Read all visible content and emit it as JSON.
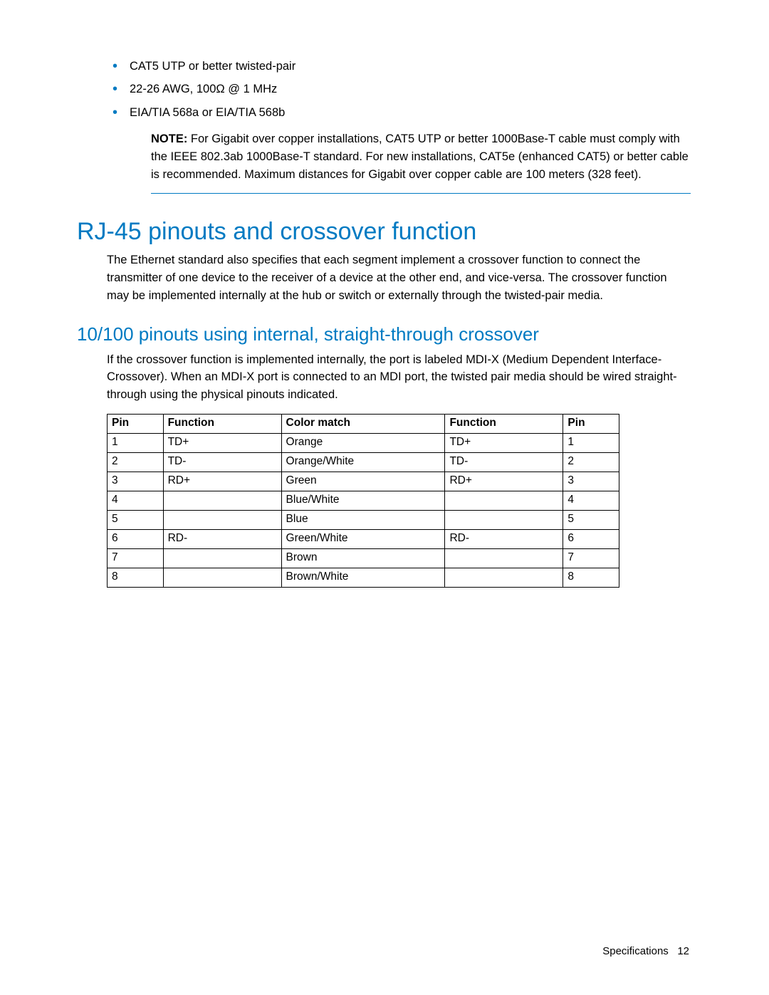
{
  "bullets": {
    "items": [
      "CAT5 UTP or better twisted-pair",
      "22-26 AWG, 100Ω @ 1 MHz",
      "EIA/TIA 568a or EIA/TIA 568b"
    ]
  },
  "note": {
    "label": "NOTE:",
    "text": "  For Gigabit over copper installations, CAT5 UTP or better 1000Base-T cable must comply with the IEEE 802.3ab 1000Base-T standard. For new installations, CAT5e (enhanced CAT5) or better cable is recommended. Maximum distances for Gigabit over copper cable are 100 meters (328 feet)."
  },
  "heading1": "RJ-45 pinouts and crossover function",
  "body1": "The Ethernet standard also specifies that each segment implement a crossover function to connect the transmitter of one device to the receiver of a device at the other end, and vice-versa. The crossover function may be implemented internally at the hub or switch or externally through the twisted-pair media.",
  "heading2": "10/100 pinouts using internal, straight-through crossover",
  "body2": "If the crossover function is implemented internally, the port is labeled MDI-X (Medium Dependent Interface-Crossover). When an MDI-X port is connected to an MDI port, the twisted pair media should be wired straight-through using the physical pinouts indicated.",
  "table": {
    "headers": [
      "Pin",
      "Function",
      "Color match",
      "Function",
      "Pin"
    ],
    "rows": [
      [
        "1",
        "TD+",
        "Orange",
        "TD+",
        "1"
      ],
      [
        "2",
        "TD-",
        "Orange/White",
        "TD-",
        "2"
      ],
      [
        "3",
        "RD+",
        "Green",
        "RD+",
        "3"
      ],
      [
        "4",
        "",
        "Blue/White",
        "",
        "4"
      ],
      [
        "5",
        "",
        "Blue",
        "",
        "5"
      ],
      [
        "6",
        "RD-",
        "Green/White",
        "RD-",
        "6"
      ],
      [
        "7",
        "",
        "Brown",
        "",
        "7"
      ],
      [
        "8",
        "",
        "Brown/White",
        "",
        "8"
      ]
    ]
  },
  "footer": {
    "section": "Specifications",
    "page": "12"
  }
}
